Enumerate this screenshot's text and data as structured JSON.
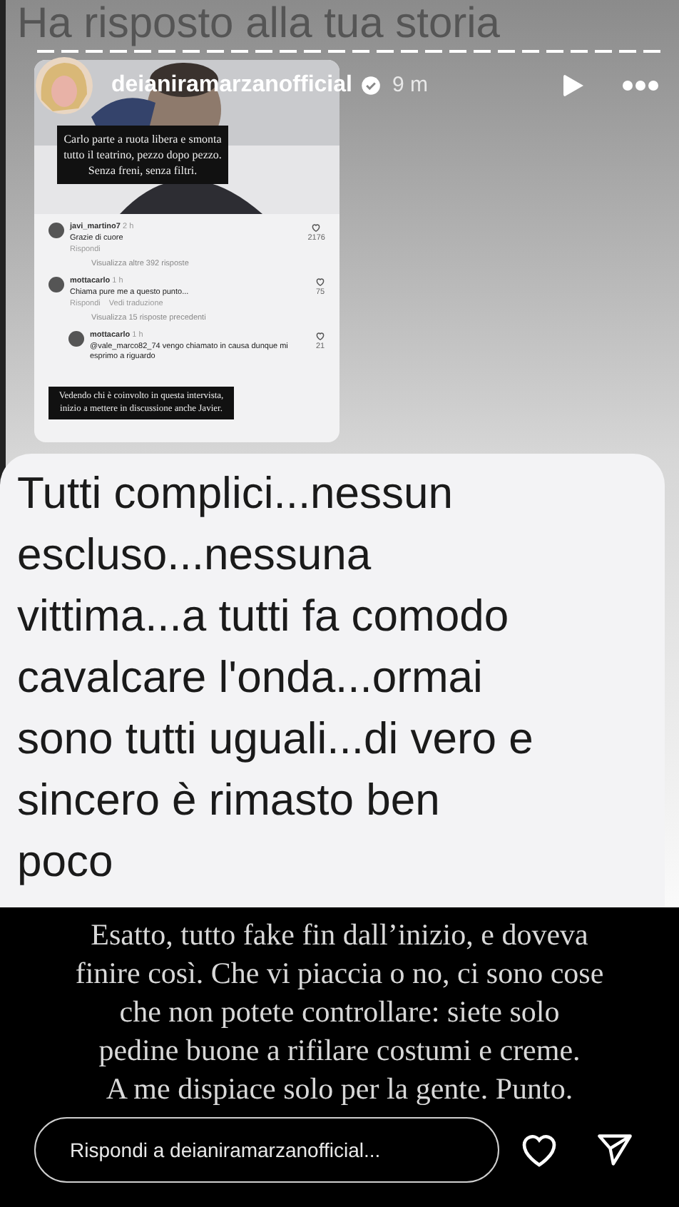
{
  "story_title": "Ha risposto alla tua storia",
  "account": {
    "username": "deianiramarzanofficial",
    "verified": true,
    "time": "9 m"
  },
  "thumbnail": {
    "caption_top": "Carlo parte a ruota libera e smonta tutto il teatrino, pezzo dopo pezzo. Senza freni, senza filtri.",
    "comments": [
      {
        "user": "javi_martino7",
        "time": "2 h",
        "text": "Grazie di cuore",
        "actions": [
          "Rispondi"
        ],
        "likes": "2176",
        "replies": "Visualizza altre 392 risposte",
        "kind": "comment"
      },
      {
        "user": "mottacarlo",
        "time": "1 h",
        "text": "Chiama pure me a questo punto...",
        "actions": [
          "Rispondi",
          "Vedi traduzione"
        ],
        "likes": "75",
        "replies": "Visualizza 15 risposte precedenti",
        "kind": "comment"
      },
      {
        "user": "mottacarlo",
        "time": "1 h",
        "text": "@vale_marco82_74 vengo chiamato in causa dunque mi esprimo a riguardo",
        "likes": "21",
        "kind": "reply"
      }
    ],
    "caption_bottom": "Vedendo chi è coinvolto in questa intervista, inizio a mettere in discussione anche Javier."
  },
  "bubble_lines": [
    "Tutti complici...nessun",
    "escluso...nessuna",
    "vittima...a tutti fa comodo",
    "cavalcare l'onda...ormai",
    "sono tutti uguali...di vero e",
    "sincero è rimasto ben",
    "poco"
  ],
  "caption_lines": [
    "Esatto, tutto fake fin dall’inizio, e doveva",
    "finire così. Che vi piaccia o no, ci sono cose",
    "che non potete controllare: siete solo",
    "pedine buone a rifilare costumi e creme.",
    "A me dispiace solo per la gente. Punto."
  ],
  "reply_field": {
    "placeholder": "Rispondi a deianiramarzanofficial..."
  }
}
